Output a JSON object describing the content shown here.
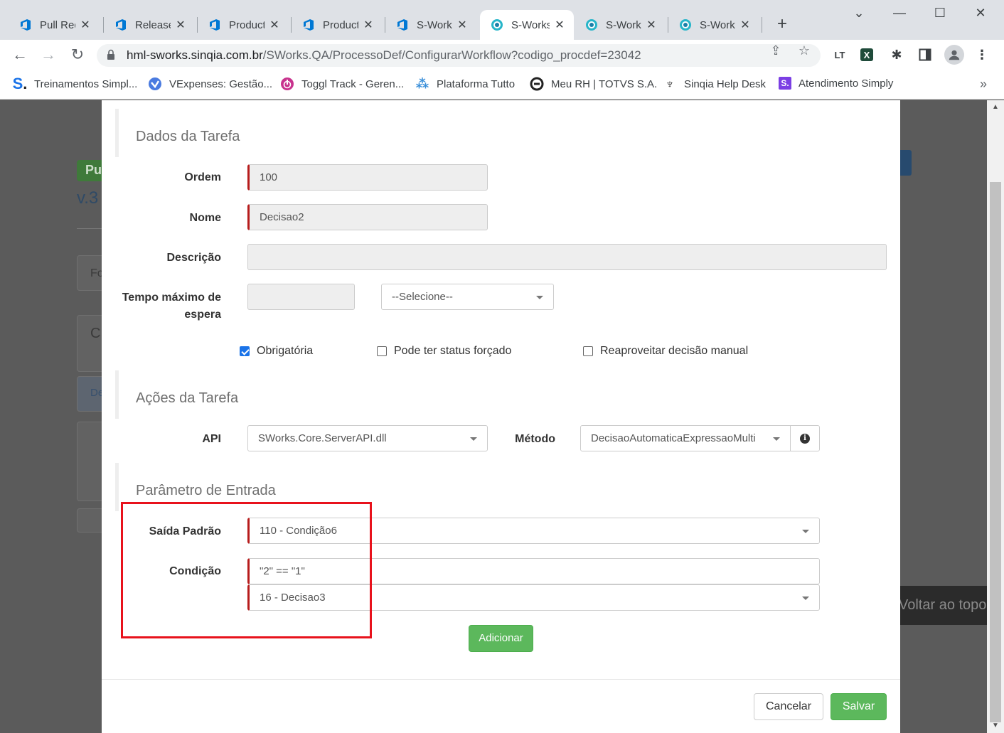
{
  "browser": {
    "tabs": [
      {
        "title": "Pull Requ",
        "icon": "azure-devops-icon",
        "active": false
      },
      {
        "title": "Releases",
        "icon": "azure-devops-icon",
        "active": false
      },
      {
        "title": "Product",
        "icon": "azure-devops-icon",
        "active": false
      },
      {
        "title": "Product",
        "icon": "azure-devops-icon",
        "active": false
      },
      {
        "title": "S-Works",
        "icon": "azure-devops-icon",
        "active": false
      },
      {
        "title": "S-Works",
        "icon": "sworks-icon",
        "active": true
      },
      {
        "title": "S-Works",
        "icon": "sworks-icon",
        "active": false
      },
      {
        "title": "S-Works",
        "icon": "sworks-icon",
        "active": false
      }
    ],
    "url_domain": "hml-sworks.sinqia.com.br",
    "url_path": "/SWorks.QA/ProcessoDef/ConfigurarWorkflow?codigo_procdef=23042",
    "extensions": [
      "LT",
      "X"
    ],
    "bookmarks": [
      {
        "label": "Treinamentos Simpl...",
        "icon": "s-logo-icon"
      },
      {
        "label": "VExpenses: Gestão...",
        "icon": "vexpenses-icon"
      },
      {
        "label": "Toggl Track - Geren...",
        "icon": "toggl-icon"
      },
      {
        "label": "Plataforma Tutto",
        "icon": "tutto-icon"
      },
      {
        "label": "Meu RH | TOTVS S.A.",
        "icon": "totvs-icon"
      },
      {
        "label": "Sinqia Help Desk",
        "icon": "helpdesk-icon"
      },
      {
        "label": "Atendimento Simply",
        "icon": "simply-icon"
      }
    ],
    "colors": {
      "tab_bg": "#dee1e6",
      "accent_blue": "#0078d4",
      "sworks_teal": "#27b5c9"
    }
  },
  "background": {
    "badge": "Pu",
    "version": "v.3",
    "box1": "Fo",
    "box2": "C",
    "box3": "De",
    "voltar": "Voltar ao topo"
  },
  "modal": {
    "section_dados": "Dados da Tarefa",
    "ordem_label": "Ordem",
    "ordem_value": "100",
    "nome_label": "Nome",
    "nome_value": "Decisao2",
    "descricao_label": "Descrição",
    "descricao_value": "",
    "tempo_label_1": "Tempo máximo de",
    "tempo_label_2": "espera",
    "tempo_value": "",
    "tempo_unit": "--Selecione--",
    "chk_obrigatoria": {
      "label": "Obrigatória",
      "checked": true
    },
    "chk_status": {
      "label": "Pode ter status forçado",
      "checked": false
    },
    "chk_reaproveitar": {
      "label": "Reaproveitar decisão manual",
      "checked": false
    },
    "section_acoes": "Ações da Tarefa",
    "api_label": "API",
    "api_value": "SWorks.Core.ServerAPI.dll",
    "metodo_label": "Método",
    "metodo_value": "DecisaoAutomaticaExpressaoMulti",
    "section_parametro": "Parâmetro de Entrada",
    "saida_label": "Saída Padrão",
    "saida_value": "110 - Condição6",
    "condicao_label": "Condição",
    "condicao_expr": "\"2\" == \"1\"",
    "condicao_target": "16 - Decisao3",
    "adicionar": "Adicionar",
    "cancelar": "Cancelar",
    "salvar": "Salvar"
  }
}
